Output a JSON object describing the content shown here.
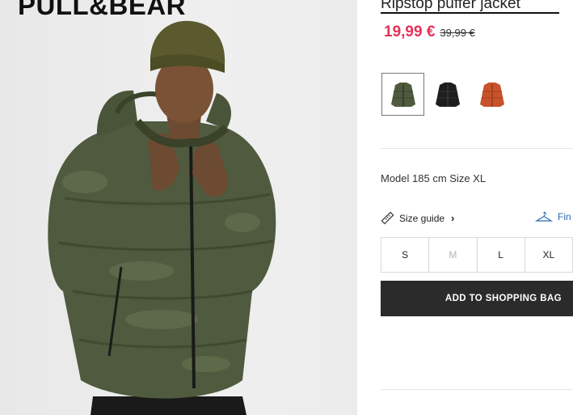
{
  "brand": {
    "logo_text": "PULL&BEAR"
  },
  "product": {
    "title": "Ripstop puffer jacket",
    "price": "19,99 €",
    "old_price": "39,99 €",
    "price_color": "#e5325a",
    "colors": [
      {
        "name": "khaki",
        "hex": "#4f5a3e",
        "selected": true
      },
      {
        "name": "black",
        "hex": "#1e1e1e",
        "selected": false
      },
      {
        "name": "orange",
        "hex": "#c8522a",
        "selected": false
      }
    ],
    "model_info": "Model 185 cm Size XL",
    "size_guide_label": "Size guide",
    "find_size_label": "Fin",
    "sizes": [
      {
        "label": "S",
        "available": true
      },
      {
        "label": "M",
        "available": false
      },
      {
        "label": "L",
        "available": true
      },
      {
        "label": "XL",
        "available": true
      }
    ],
    "add_to_bag_label": "ADD TO SHOPPING BAG"
  },
  "icons": {
    "size_guide": "ruler-icon",
    "find_size": "hanger-icon",
    "size_guide_chevron": "chevron-right-icon"
  }
}
